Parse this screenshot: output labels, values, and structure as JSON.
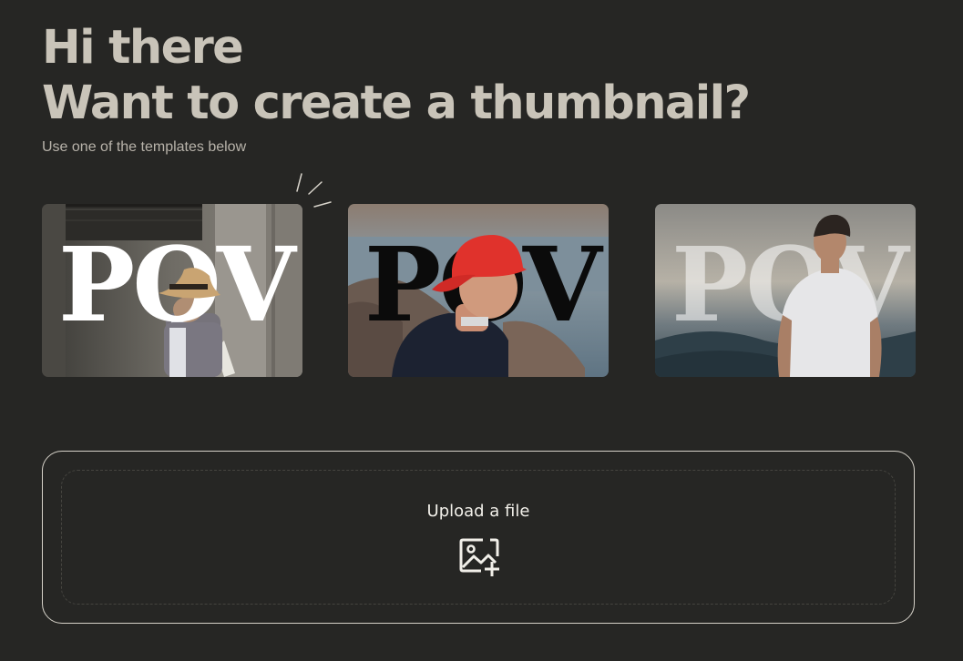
{
  "header": {
    "greeting": "Hi there",
    "question": "Want to create a thumbnail?",
    "subtitle": "Use one of the templates below"
  },
  "templates": [
    {
      "text": "POV",
      "icon": "template-person-hat-thumbnail"
    },
    {
      "text": "POV",
      "icon": "template-person-red-cap-thumbnail"
    },
    {
      "text": "POV",
      "icon": "template-person-mountain-thumbnail"
    }
  ],
  "upload": {
    "label": "Upload a file",
    "icon": "add-image-icon"
  },
  "colors": {
    "background": "#262624",
    "heading": "#c9c4b9",
    "subtitle": "#b8b3aa",
    "upload_border": "#d6d2c9"
  }
}
